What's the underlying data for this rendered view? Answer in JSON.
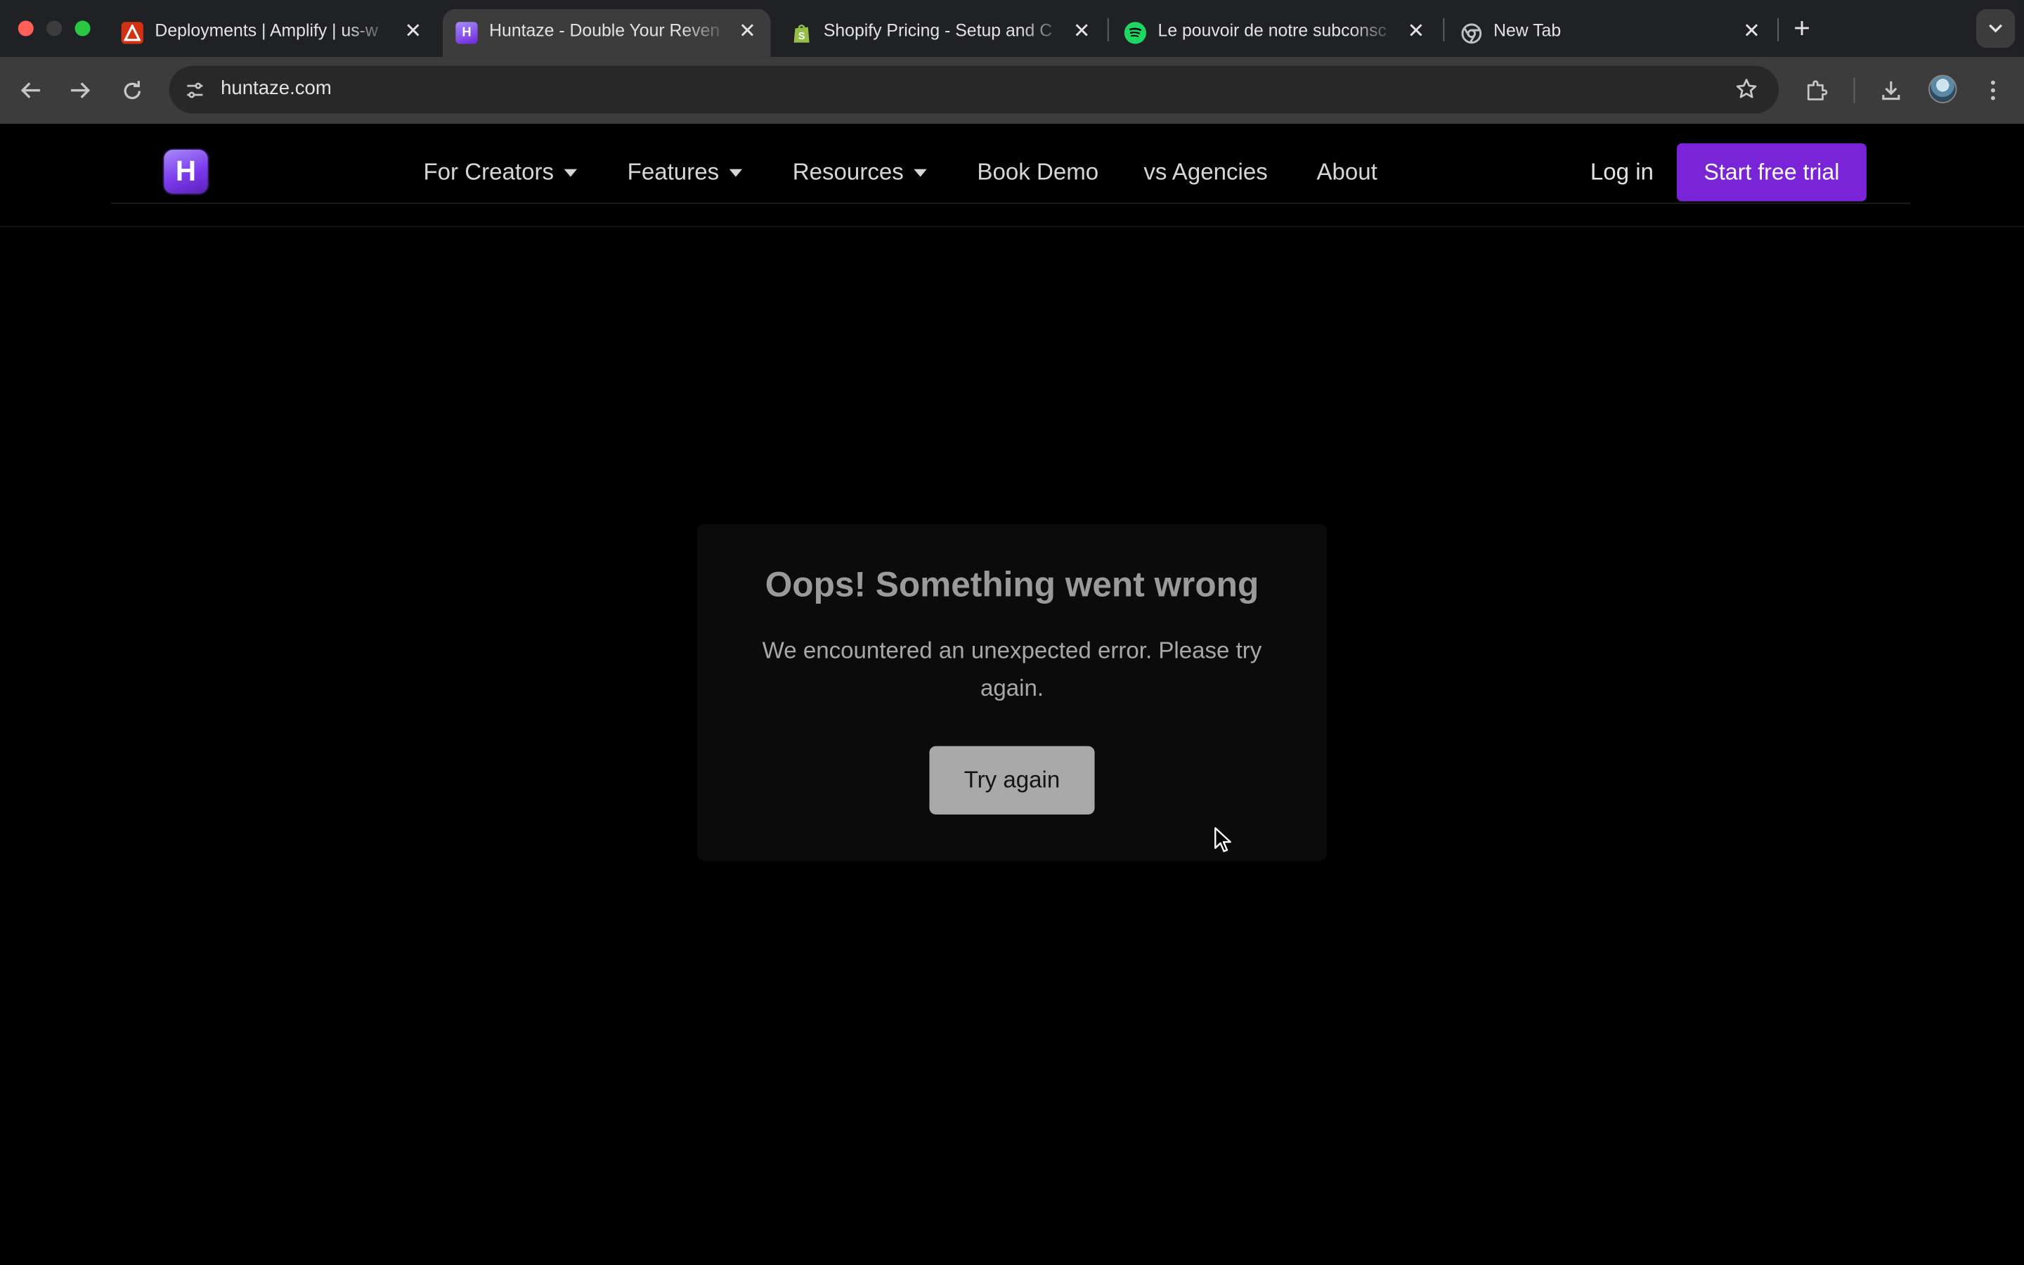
{
  "browser": {
    "tabs": [
      {
        "title": "Deployments | Amplify | us-w",
        "favicon": "aws-amplify-icon",
        "active": false
      },
      {
        "title": "Huntaze - Double Your Reven",
        "favicon": "huntaze-icon",
        "active": true
      },
      {
        "title": "Shopify Pricing - Setup and C",
        "favicon": "shopify-icon",
        "active": false
      },
      {
        "title": "Le pouvoir de notre subconsc",
        "favicon": "spotify-icon",
        "active": false
      },
      {
        "title": "New Tab",
        "favicon": "chrome-icon",
        "active": false
      }
    ],
    "address_bar": {
      "url": "huntaze.com"
    }
  },
  "site": {
    "logo_letter": "H",
    "nav": {
      "items": [
        {
          "label": "For Creators",
          "has_dropdown": true
        },
        {
          "label": "Features",
          "has_dropdown": true
        },
        {
          "label": "Resources",
          "has_dropdown": true
        },
        {
          "label": "Book Demo",
          "has_dropdown": false
        },
        {
          "label": "vs Agencies",
          "has_dropdown": false
        },
        {
          "label": "About",
          "has_dropdown": false
        }
      ],
      "login_label": "Log in",
      "cta_label": "Start free trial"
    },
    "error": {
      "title": "Oops! Something went wrong",
      "message": "We encountered an unexpected error. Please try again.",
      "button_label": "Try again"
    }
  },
  "colors": {
    "accent": "#7a24d8",
    "page_background": "#000000",
    "tab_strip": "#202124",
    "toolbar": "#3c3c3c"
  }
}
